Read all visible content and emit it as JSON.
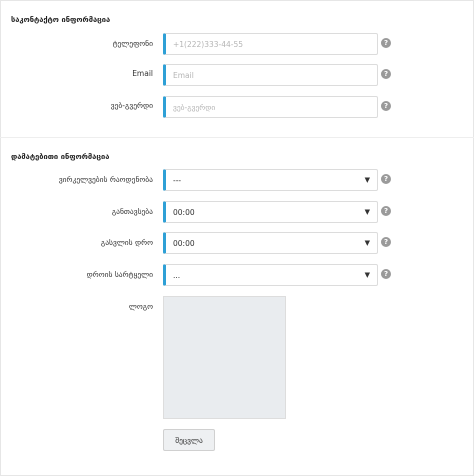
{
  "contact_section": {
    "title": "საკონტაქტო ინფორმაცია",
    "phone": {
      "label": "ტელეფონი",
      "value": "",
      "placeholder": "+1(222)333-44-55"
    },
    "email": {
      "label": "Email",
      "value": "",
      "placeholder": "Email"
    },
    "website": {
      "label": "ვებ-გვერდი",
      "value": "",
      "placeholder": "ვებ-გვერდი"
    }
  },
  "additional_section": {
    "title": "დამატებითი ინფორმაცია",
    "work_days": {
      "label": "ვირკელვების რაოდენობა",
      "value": "---"
    },
    "opening_time": {
      "label": "განთავსება",
      "value": "00:00"
    },
    "closing_time": {
      "label": "გასვლის დრო",
      "value": "00:00"
    },
    "timezone": {
      "label": "დროის სარტყელი",
      "value": "..."
    },
    "logo": {
      "label": "ლოგო"
    },
    "save_label": "შეცვლა"
  },
  "icons": {
    "help": "question-circle-icon",
    "dropdown": "triangle-down-icon"
  },
  "colors": {
    "accent": "#2ea0d6",
    "help_icon": "#9a9a9a",
    "logo_placeholder": "#e9ecef"
  }
}
